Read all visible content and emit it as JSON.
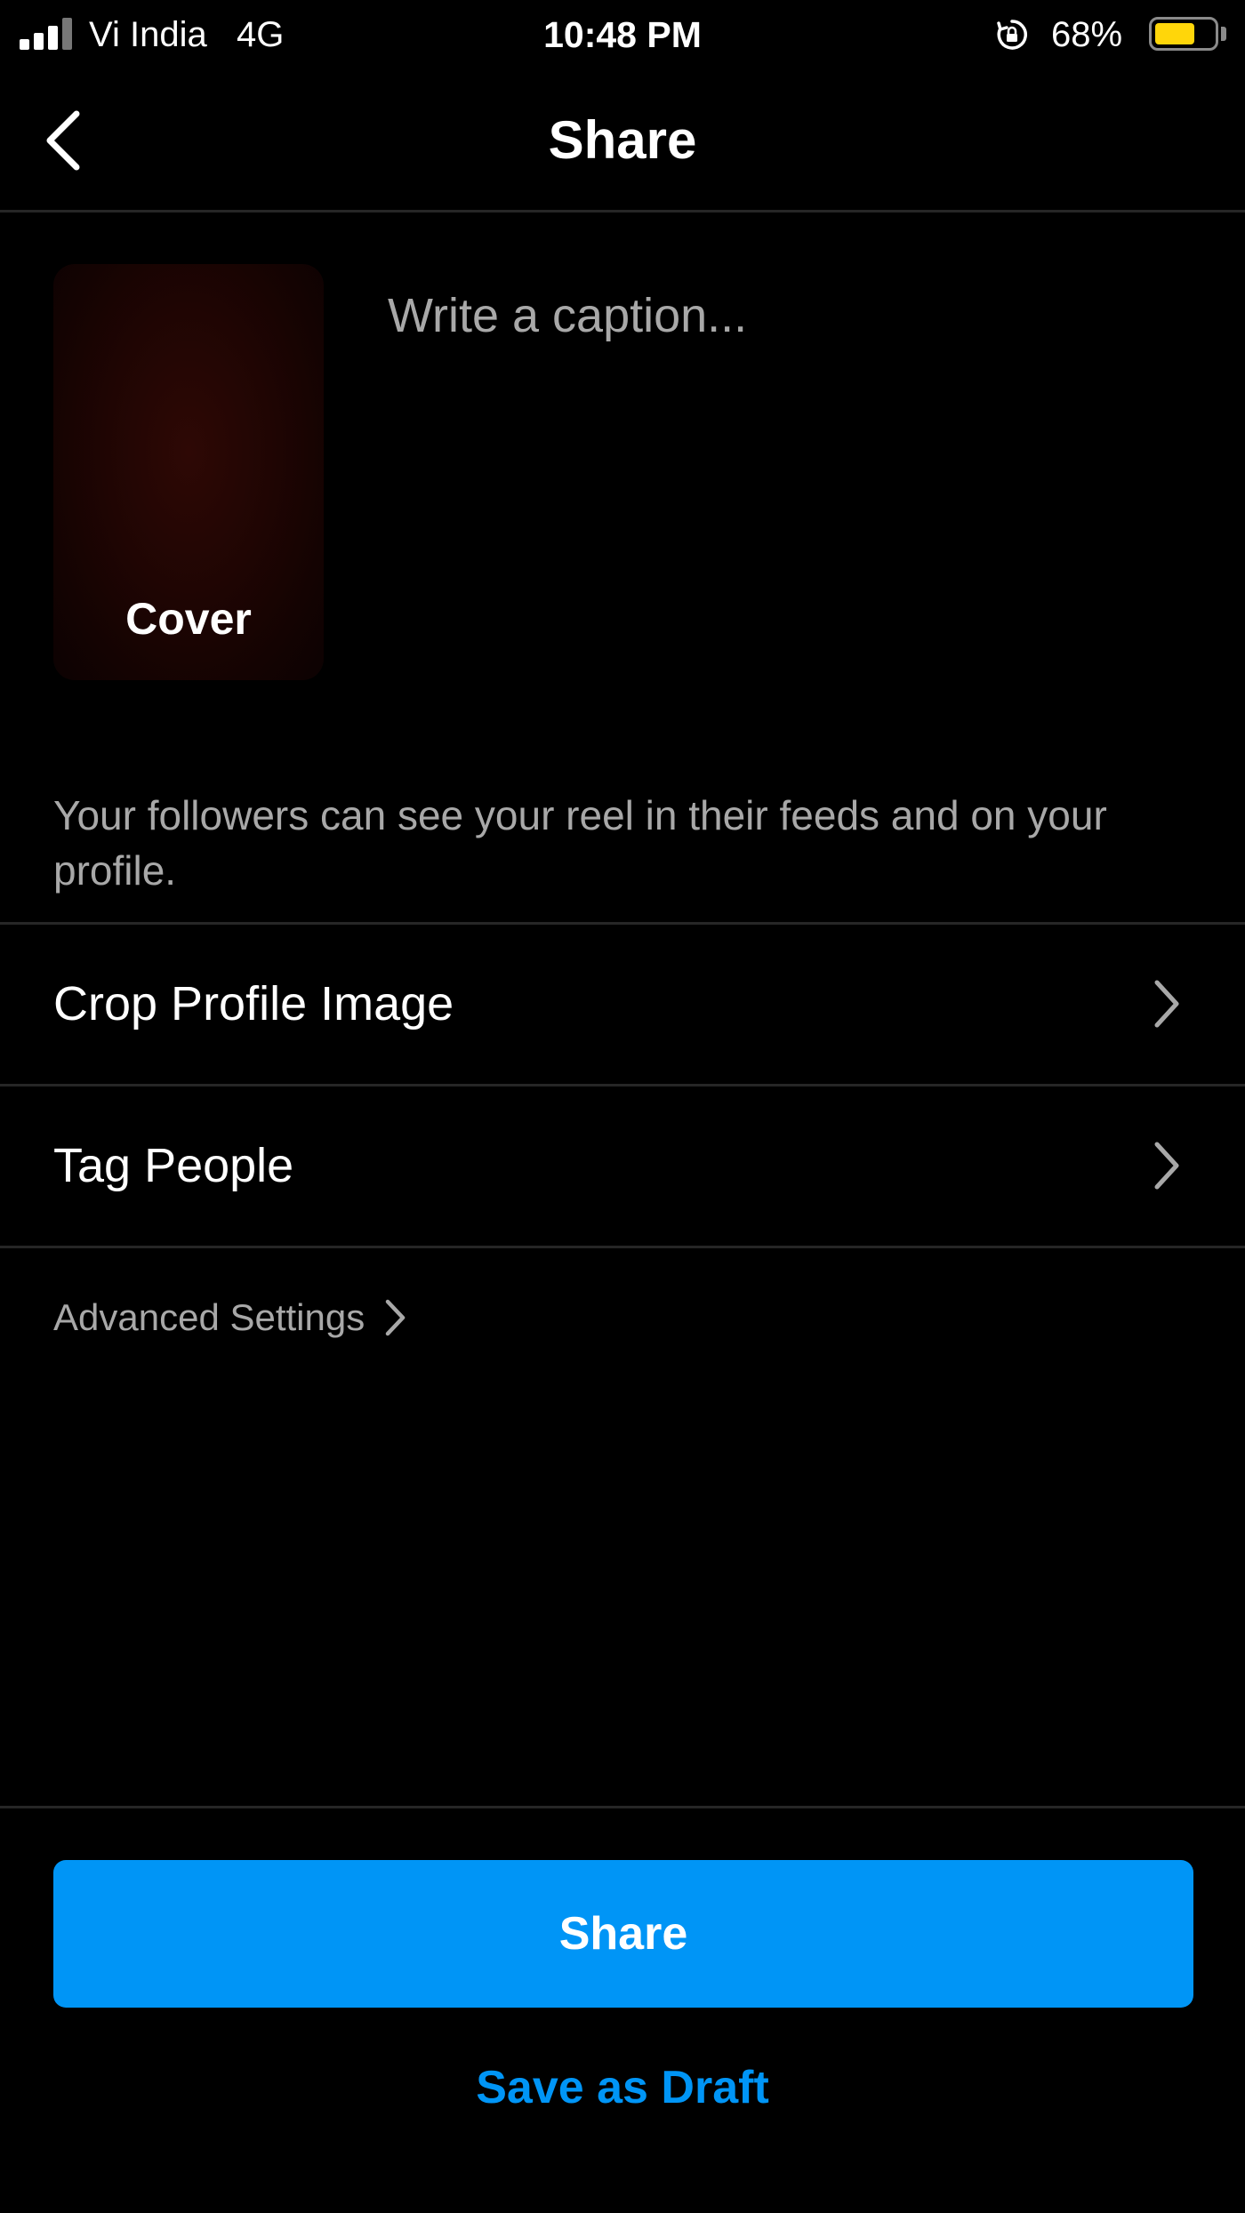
{
  "status_bar": {
    "carrier": "Vi India",
    "network": "4G",
    "time": "10:48 PM",
    "battery_percent": "68%",
    "battery_level": 0.68,
    "icons": [
      "signal-icon",
      "rotation-lock-icon",
      "battery-icon"
    ]
  },
  "header": {
    "title": "Share",
    "back_icon": "chevron-left-icon"
  },
  "cover": {
    "label": "Cover"
  },
  "caption": {
    "placeholder": "Write a caption...",
    "value": ""
  },
  "info_text": "Your followers can see your reel in their feeds and on your profile.",
  "options": [
    {
      "label": "Crop Profile Image",
      "icon": "chevron-right-icon"
    },
    {
      "label": "Tag People",
      "icon": "chevron-right-icon"
    }
  ],
  "advanced_settings": {
    "label": "Advanced Settings",
    "icon": "chevron-right-icon"
  },
  "actions": {
    "share_label": "Share",
    "save_draft_label": "Save as Draft"
  },
  "colors": {
    "background": "#000000",
    "accent": "#0095f6",
    "secondary_text": "#a8a8a8",
    "divider": "#262626",
    "battery": "#ffd60a"
  }
}
